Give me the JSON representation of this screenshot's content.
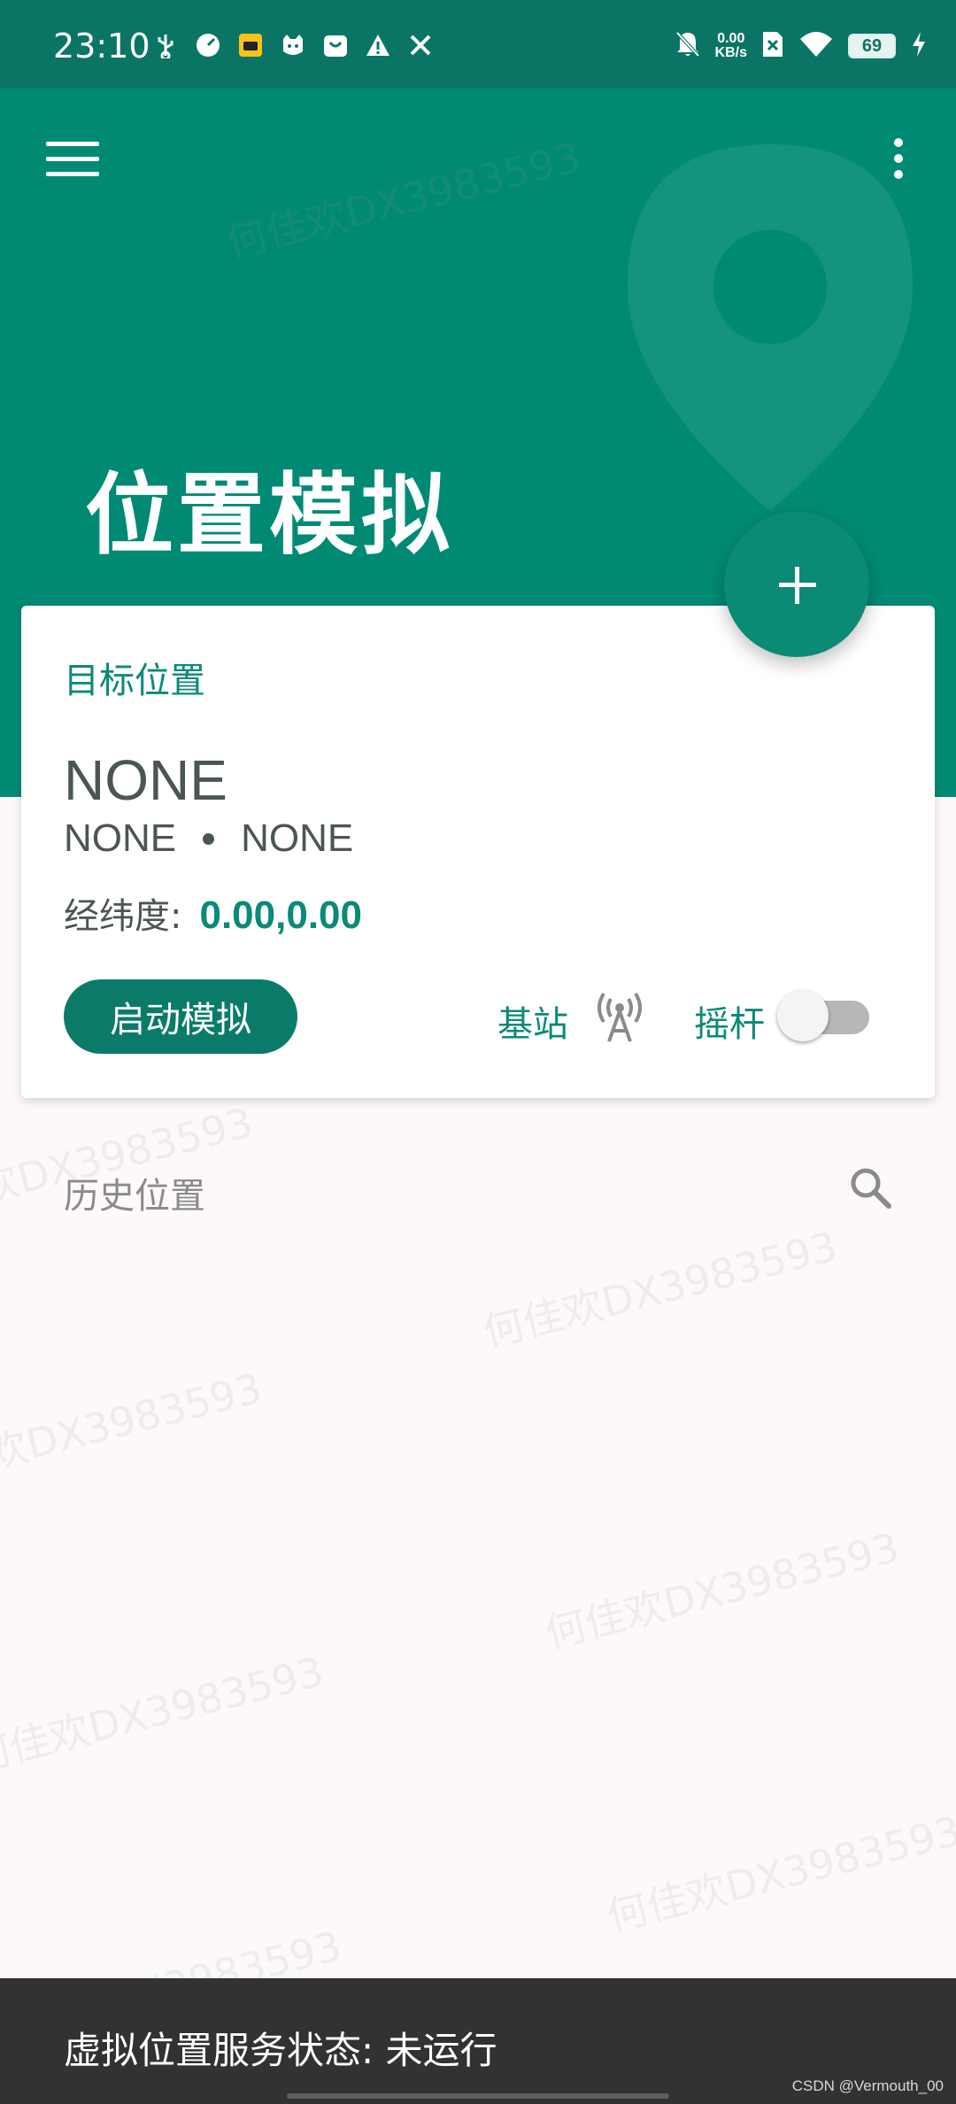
{
  "status_bar": {
    "time": "23:10",
    "net_speed_value": "0.00",
    "net_speed_unit": "KB/s",
    "battery": "69",
    "left_icons": [
      "usb-icon",
      "speedometer-icon",
      "taxi-icon",
      "cat-icon",
      "shopping-bag-icon",
      "warning-icon",
      "tools-icon"
    ],
    "right_icons": [
      "mute-bell-icon",
      "no-sim-icon",
      "wifi-icon",
      "battery-icon",
      "charging-icon"
    ]
  },
  "header": {
    "title": "位置模拟",
    "accent_color": "#008a74"
  },
  "card": {
    "label": "目标位置",
    "name": "NONE",
    "sub_left": "NONE",
    "sub_right": "NONE",
    "coord_label": "经纬度:",
    "coord_value": "0.00,0.00",
    "start_button": "启动模拟",
    "cell_label": "基站",
    "joystick_label": "摇杆",
    "joystick_on": false
  },
  "history": {
    "title": "历史位置"
  },
  "watermark_text": "何佳欢DX3983593",
  "bottom": {
    "status_text": "虚拟位置服务状态: 未运行",
    "credit": "CSDN @Vermouth_00"
  }
}
